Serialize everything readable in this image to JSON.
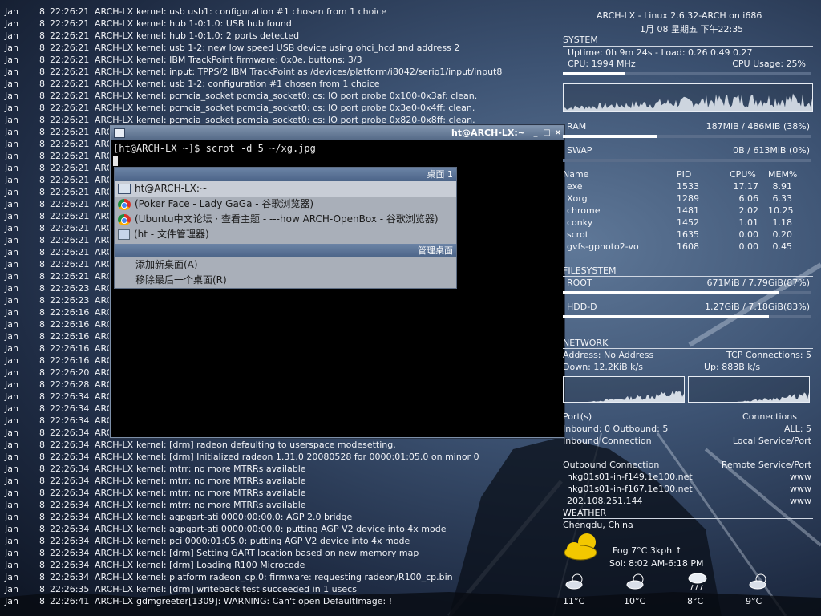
{
  "log_lines": [
    {
      "m": "Jan",
      "d": "8",
      "t": "22:26:21",
      "h": "ARCH-LX",
      "p": "kernel: usb usb1: configuration #1 chosen from 1 choice"
    },
    {
      "m": "Jan",
      "d": "8",
      "t": "22:26:21",
      "h": "ARCH-LX",
      "p": "kernel: hub 1-0:1.0: USB hub found"
    },
    {
      "m": "Jan",
      "d": "8",
      "t": "22:26:21",
      "h": "ARCH-LX",
      "p": "kernel: hub 1-0:1.0: 2 ports detected"
    },
    {
      "m": "Jan",
      "d": "8",
      "t": "22:26:21",
      "h": "ARCH-LX",
      "p": "kernel: usb 1-2: new low speed USB device using ohci_hcd and address 2"
    },
    {
      "m": "Jan",
      "d": "8",
      "t": "22:26:21",
      "h": "ARCH-LX",
      "p": "kernel: IBM TrackPoint firmware: 0x0e, buttons: 3/3"
    },
    {
      "m": "Jan",
      "d": "8",
      "t": "22:26:21",
      "h": "ARCH-LX",
      "p": "kernel: input: TPPS/2 IBM TrackPoint as /devices/platform/i8042/serio1/input/input8"
    },
    {
      "m": "Jan",
      "d": "8",
      "t": "22:26:21",
      "h": "ARCH-LX",
      "p": "kernel: usb 1-2: configuration #1 chosen from 1 choice"
    },
    {
      "m": "Jan",
      "d": "8",
      "t": "22:26:21",
      "h": "ARCH-LX",
      "p": "kernel: pcmcia_socket pcmcia_socket0: cs: IO port probe 0x100-0x3af: clean."
    },
    {
      "m": "Jan",
      "d": "8",
      "t": "22:26:21",
      "h": "ARCH-LX",
      "p": "kernel: pcmcia_socket pcmcia_socket0: cs: IO port probe 0x3e0-0x4ff: clean."
    },
    {
      "m": "Jan",
      "d": "8",
      "t": "22:26:21",
      "h": "ARCH-LX",
      "p": "kernel: pcmcia_socket pcmcia_socket0: cs: IO port probe 0x820-0x8ff: clean."
    },
    {
      "m": "Jan",
      "d": "8",
      "t": "22:26:21",
      "h": "ARCH-LX",
      "p": ""
    },
    {
      "m": "Jan",
      "d": "8",
      "t": "22:26:21",
      "h": "ARCH-LX",
      "p": ""
    },
    {
      "m": "Jan",
      "d": "8",
      "t": "22:26:21",
      "h": "ARCH-LX",
      "p": ""
    },
    {
      "m": "Jan",
      "d": "8",
      "t": "22:26:21",
      "h": "ARCH-LX",
      "p": ""
    },
    {
      "m": "Jan",
      "d": "8",
      "t": "22:26:21",
      "h": "ARCH-LX",
      "p": ""
    },
    {
      "m": "Jan",
      "d": "8",
      "t": "22:26:21",
      "h": "ARCH-LX",
      "p": ""
    },
    {
      "m": "Jan",
      "d": "8",
      "t": "22:26:21",
      "h": "ARCH-LX",
      "p": ""
    },
    {
      "m": "Jan",
      "d": "8",
      "t": "22:26:21",
      "h": "ARCH-LX",
      "p": ""
    },
    {
      "m": "Jan",
      "d": "8",
      "t": "22:26:21",
      "h": "ARCH-LX",
      "p": ""
    },
    {
      "m": "Jan",
      "d": "8",
      "t": "22:26:21",
      "h": "ARCH-LX",
      "p": ""
    },
    {
      "m": "Jan",
      "d": "8",
      "t": "22:26:21",
      "h": "ARCH-LX",
      "p": ""
    },
    {
      "m": "Jan",
      "d": "8",
      "t": "22:26:21",
      "h": "ARCH-LX",
      "p": ""
    },
    {
      "m": "Jan",
      "d": "8",
      "t": "22:26:21",
      "h": "ARCH-LX",
      "p": ""
    },
    {
      "m": "Jan",
      "d": "8",
      "t": "22:26:23",
      "h": "ARCH-LX",
      "p": ""
    },
    {
      "m": "Jan",
      "d": "8",
      "t": "22:26:23",
      "h": "ARCH-LX",
      "p": ""
    },
    {
      "m": "Jan",
      "d": "8",
      "t": "22:26:16",
      "h": "ARCH-LX",
      "p": ""
    },
    {
      "m": "Jan",
      "d": "8",
      "t": "22:26:16",
      "h": "ARCH-LX",
      "p": ""
    },
    {
      "m": "Jan",
      "d": "8",
      "t": "22:26:16",
      "h": "ARCH-LX",
      "p": ""
    },
    {
      "m": "Jan",
      "d": "8",
      "t": "22:26:16",
      "h": "ARCH-LX",
      "p": ""
    },
    {
      "m": "Jan",
      "d": "8",
      "t": "22:26:16",
      "h": "ARCH-LX",
      "p": ""
    },
    {
      "m": "Jan",
      "d": "8",
      "t": "22:26:20",
      "h": "ARCH-LX",
      "p": ""
    },
    {
      "m": "Jan",
      "d": "8",
      "t": "22:26:28",
      "h": "ARCH-LX",
      "p": ""
    },
    {
      "m": "Jan",
      "d": "8",
      "t": "22:26:34",
      "h": "ARCH-LX",
      "p": ""
    },
    {
      "m": "Jan",
      "d": "8",
      "t": "22:26:34",
      "h": "ARCH-LX",
      "p": ""
    },
    {
      "m": "Jan",
      "d": "8",
      "t": "22:26:34",
      "h": "ARCH-LX",
      "p": ""
    },
    {
      "m": "Jan",
      "d": "8",
      "t": "22:26:34",
      "h": "ARCH-LX",
      "p": ""
    },
    {
      "m": "Jan",
      "d": "8",
      "t": "22:26:34",
      "h": "ARCH-LX",
      "p": "kernel: [drm] radeon defaulting to userspace modesetting."
    },
    {
      "m": "Jan",
      "d": "8",
      "t": "22:26:34",
      "h": "ARCH-LX",
      "p": "kernel: [drm] Initialized radeon 1.31.0 20080528 for 0000:01:05.0 on minor 0"
    },
    {
      "m": "Jan",
      "d": "8",
      "t": "22:26:34",
      "h": "ARCH-LX",
      "p": "kernel: mtrr: no more MTRRs available"
    },
    {
      "m": "Jan",
      "d": "8",
      "t": "22:26:34",
      "h": "ARCH-LX",
      "p": "kernel: mtrr: no more MTRRs available"
    },
    {
      "m": "Jan",
      "d": "8",
      "t": "22:26:34",
      "h": "ARCH-LX",
      "p": "kernel: mtrr: no more MTRRs available"
    },
    {
      "m": "Jan",
      "d": "8",
      "t": "22:26:34",
      "h": "ARCH-LX",
      "p": "kernel: mtrr: no more MTRRs available"
    },
    {
      "m": "Jan",
      "d": "8",
      "t": "22:26:34",
      "h": "ARCH-LX",
      "p": "kernel: agpgart-ati 0000:00:00.0: AGP 2.0 bridge"
    },
    {
      "m": "Jan",
      "d": "8",
      "t": "22:26:34",
      "h": "ARCH-LX",
      "p": "kernel: agpgart-ati 0000:00:00.0: putting AGP V2 device into 4x mode"
    },
    {
      "m": "Jan",
      "d": "8",
      "t": "22:26:34",
      "h": "ARCH-LX",
      "p": "kernel: pci 0000:01:05.0: putting AGP V2 device into 4x mode"
    },
    {
      "m": "Jan",
      "d": "8",
      "t": "22:26:34",
      "h": "ARCH-LX",
      "p": "kernel: [drm] Setting GART location based on new memory map"
    },
    {
      "m": "Jan",
      "d": "8",
      "t": "22:26:34",
      "h": "ARCH-LX",
      "p": "kernel: [drm] Loading R100 Microcode"
    },
    {
      "m": "Jan",
      "d": "8",
      "t": "22:26:34",
      "h": "ARCH-LX",
      "p": "kernel: platform radeon_cp.0: firmware: requesting radeon/R100_cp.bin"
    },
    {
      "m": "Jan",
      "d": "8",
      "t": "22:26:35",
      "h": "ARCH-LX",
      "p": "kernel: [drm] writeback test succeeded in 1 usecs"
    },
    {
      "m": "Jan",
      "d": "8",
      "t": "22:26:41",
      "h": "ARCH-LX",
      "p": "gdmgreeter[1309]: WARNING: Can't open DefaultImage: !"
    }
  ],
  "terminal": {
    "title": "ht@ARCH-LX:~",
    "controls": [
      "_",
      "□",
      "×"
    ],
    "prompt": "[ht@ARCH-LX ~]$ scrot -d 5 ~/xg.jpg"
  },
  "menu": {
    "header": "桌面 1",
    "items": [
      {
        "label": "ht@ARCH-LX:~",
        "icon": "terminal-window-icon"
      },
      {
        "label": "(Poker Face - Lady GaGa - 谷歌浏览器)",
        "icon": "chrome-icon"
      },
      {
        "label": "(Ubuntu中文论坛 · 查看主题 - ---how ARCH-OpenBox - 谷歌浏览器)",
        "icon": "chrome-icon"
      },
      {
        "label": "(ht - 文件管理器)",
        "icon": "folder-home-icon"
      }
    ],
    "manage_header": "管理桌面",
    "manage_items": [
      "添加新桌面(A)",
      "移除最后一个桌面(R)"
    ]
  },
  "conky": {
    "header_line": "ARCH-LX - Linux 2.6.32-ARCH on i686",
    "date_line": "1月 08 星期五 下午22:35",
    "system_label": "SYSTEM",
    "uptime": "Uptime: 0h 9m 24s - Load: 0.26 0.49 0.27",
    "cpu_freq": "CPU: 1994 MHz",
    "cpu_usage": "CPU Usage: 25%",
    "cpu_usage_fraction": 0.25,
    "ram_label": "RAM",
    "ram_value": "187MiB / 486MiB (38%)",
    "ram_fraction": 0.38,
    "swap_label": "SWAP",
    "swap_value": "0B / 613MiB (0%)",
    "swap_fraction": 0.0,
    "proc_headers": [
      "Name",
      "PID",
      "CPU%",
      "MEM%"
    ],
    "processes": [
      [
        "exe",
        "1533",
        "17.17",
        "8.91"
      ],
      [
        "Xorg",
        "1289",
        "6.06",
        "6.33"
      ],
      [
        "chrome",
        "1481",
        "2.02",
        "10.25"
      ],
      [
        "conky",
        "1452",
        "1.01",
        "1.18"
      ],
      [
        "scrot",
        "1635",
        "0.00",
        "0.20"
      ],
      [
        "gvfs-gphoto2-vo",
        "1608",
        "0.00",
        "0.45"
      ]
    ],
    "fs_label": "FILESYSTEM",
    "root_label": "ROOT",
    "root_value": "671MiB / 7.79GiB(87%)",
    "root_fraction": 0.87,
    "hdd_label": "HDD-D",
    "hdd_value": "1.27GiB / 7.18GiB(83%)",
    "hdd_fraction": 0.83,
    "network_label": "NETWORK",
    "address": "Address: No Address",
    "tcp": "TCP Connections: 5",
    "down": "Down: 12.2KiB k/s",
    "up": "Up: 883B  k/s",
    "ports": "Port(s)",
    "connections": "Connections",
    "inbound": "Inbound: 0  Outbound: 5",
    "all": "ALL: 5",
    "inbound_conn": "Inbound Connection",
    "local_service": "Local Service/Port",
    "outbound_conn": "Outbound Connection",
    "remote_service": "Remote Service/Port",
    "outbound_rows": [
      [
        "hkg01s01-in-f149.1e100.net",
        "www"
      ],
      [
        "hkg01s01-in-f167.1e100.net",
        "www"
      ],
      [
        "202.108.251.144",
        "www"
      ]
    ],
    "weather_label": "WEATHER",
    "location": "Chengdu, China",
    "condition": "Fog  7°C  3kph  ↑",
    "sun": "Sol: 8:02 AM-6:18 PM",
    "forecast": [
      "11°C",
      "10°C",
      "8°C",
      "9°C"
    ]
  }
}
